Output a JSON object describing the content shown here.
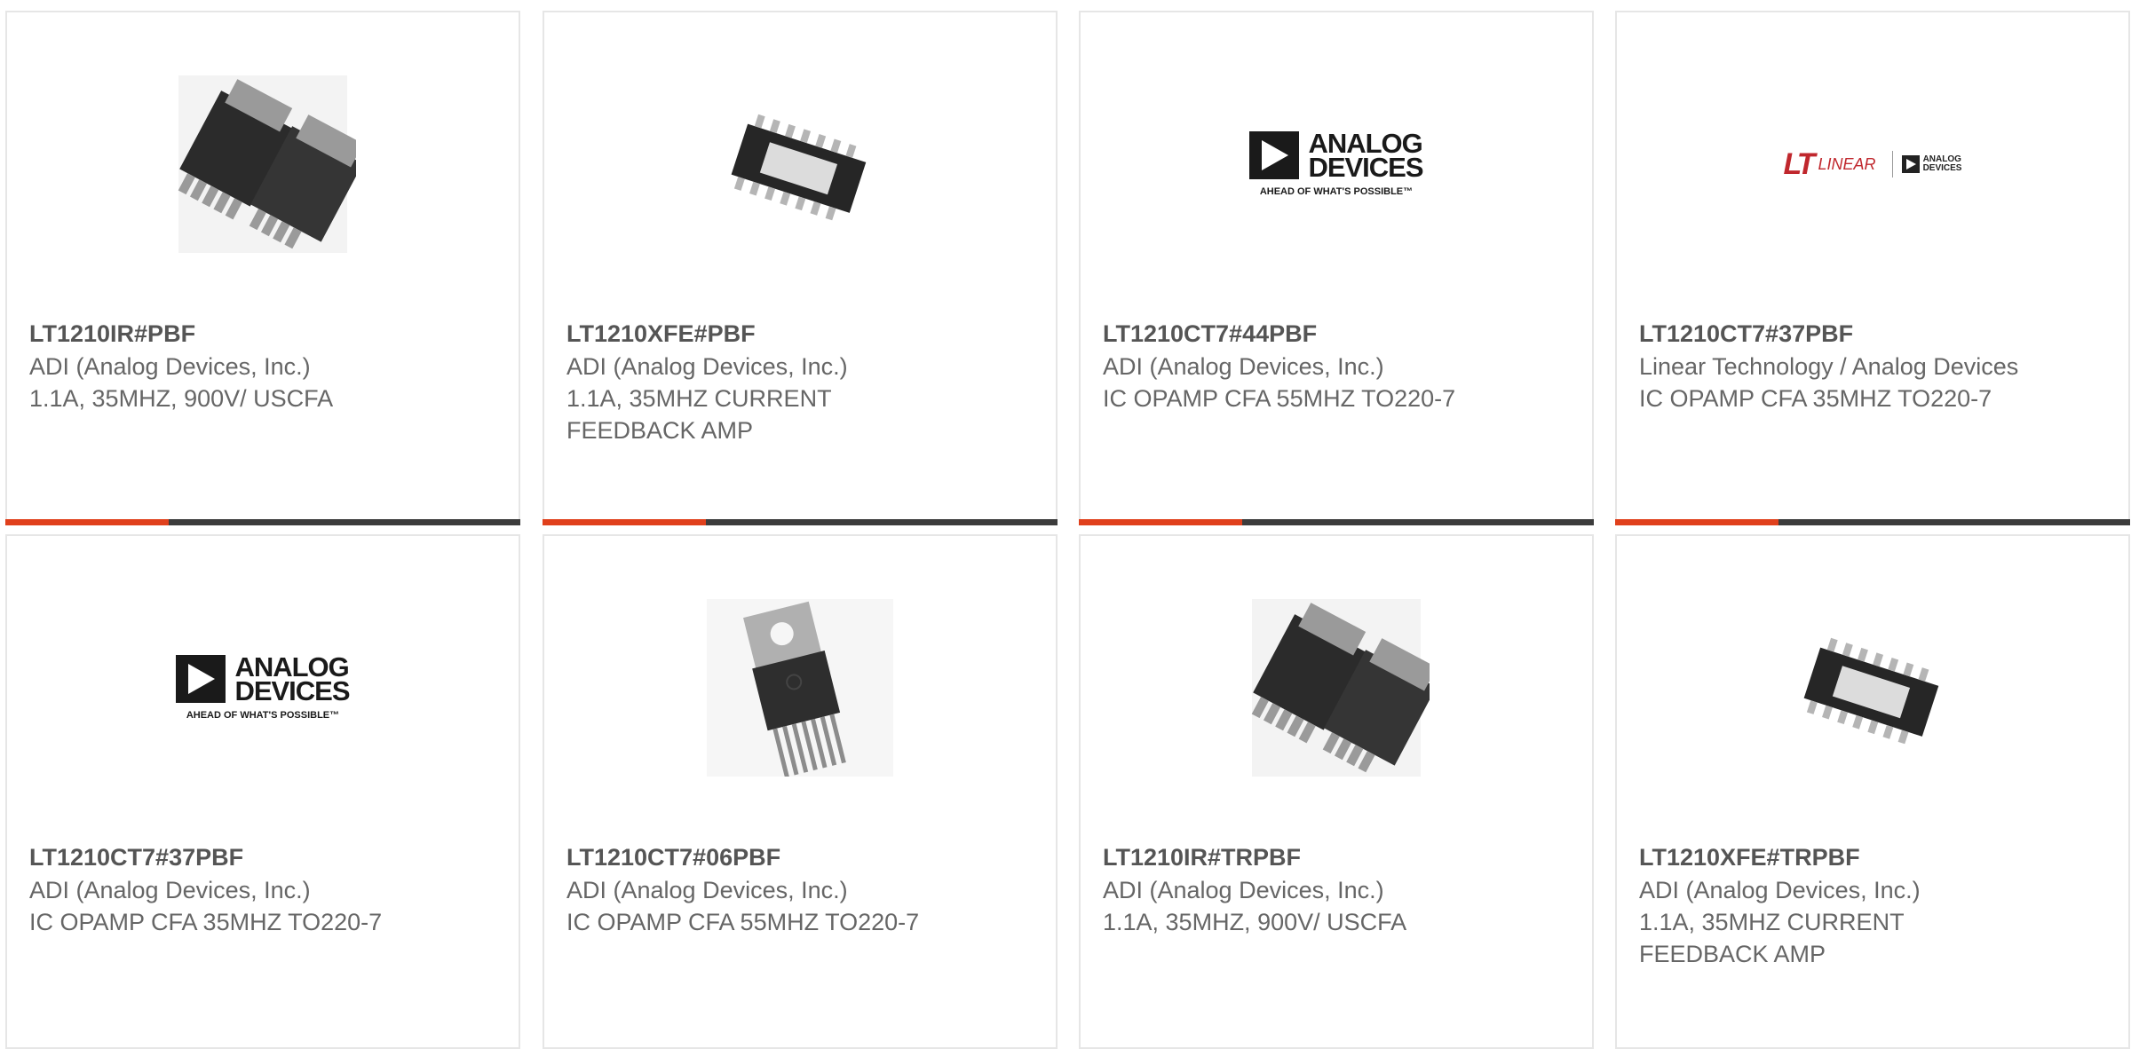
{
  "colors": {
    "accent": "#e0401c",
    "bar": "#3c3c3c",
    "border": "#e6e6e6",
    "text": "#666666",
    "part": "#555555"
  },
  "brand": {
    "adi_name_line1": "ANALOG",
    "adi_name_line2": "DEVICES",
    "adi_tagline": "AHEAD OF WHAT'S POSSIBLE™",
    "lt_word": "LINEAR",
    "lt_adi_line1": "ANALOG",
    "lt_adi_line2": "DEVICES"
  },
  "products": [
    {
      "part": "LT1210IR#PBF",
      "manufacturer": "ADI (Analog Devices, Inc.)",
      "description": "1.1A, 35MHZ, 900V/ USCFA",
      "image_icon": "dd-pak-chip-icon"
    },
    {
      "part": "LT1210XFE#PBF",
      "manufacturer": "ADI (Analog Devices, Inc.)",
      "description": "1.1A, 35MHZ CURRENT FEEDBACK AMP",
      "image_icon": "tssop-chip-icon"
    },
    {
      "part": "LT1210CT7#44PBF",
      "manufacturer": "ADI (Analog Devices, Inc.)",
      "description": "IC OPAMP CFA 55MHZ TO220-7",
      "image_icon": "analog-devices-logo"
    },
    {
      "part": "LT1210CT7#37PBF",
      "manufacturer": "Linear Technology / Analog Devices",
      "description": "IC OPAMP CFA 35MHZ TO220-7",
      "image_icon": "linear-technology-logo"
    },
    {
      "part": "LT1210CT7#37PBF",
      "manufacturer": "ADI (Analog Devices, Inc.)",
      "description": "IC OPAMP CFA 35MHZ TO220-7",
      "image_icon": "analog-devices-logo"
    },
    {
      "part": "LT1210CT7#06PBF",
      "manufacturer": "ADI (Analog Devices, Inc.)",
      "description": "IC OPAMP CFA 55MHZ TO220-7",
      "image_icon": "to220-chip-icon"
    },
    {
      "part": "LT1210IR#TRPBF",
      "manufacturer": "ADI (Analog Devices, Inc.)",
      "description": "1.1A, 35MHZ, 900V/ USCFA",
      "image_icon": "dd-pak-chip-icon"
    },
    {
      "part": "LT1210XFE#TRPBF",
      "manufacturer": "ADI (Analog Devices, Inc.)",
      "description": "1.1A, 35MHZ CURRENT FEEDBACK AMP",
      "image_icon": "tssop-chip-icon"
    }
  ]
}
